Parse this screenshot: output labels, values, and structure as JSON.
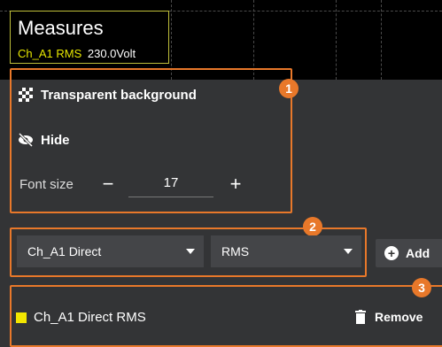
{
  "measures": {
    "title": "Measures",
    "channel": "Ch_A1 RMS",
    "value": "230.0Volt"
  },
  "section1": {
    "badge": "1",
    "transparent_label": "Transparent background",
    "hide_label": "Hide",
    "font_size_label": "Font size",
    "font_size_value": "17",
    "minus": "−",
    "plus": "+"
  },
  "section2": {
    "badge": "2",
    "source_select": "Ch_A1 Direct",
    "type_select": "RMS",
    "add_label": "Add"
  },
  "section3": {
    "badge": "3",
    "item_label": "Ch_A1 Direct RMS",
    "remove_label": "Remove"
  },
  "colors": {
    "accent": "#e8782a",
    "channel_yellow": "#f2e600",
    "measures_border": "#c0c03a"
  },
  "icons": [
    "checkerboard-icon",
    "eye-slash-icon",
    "plus-circle-icon",
    "trash-icon",
    "caret-down-icon"
  ]
}
